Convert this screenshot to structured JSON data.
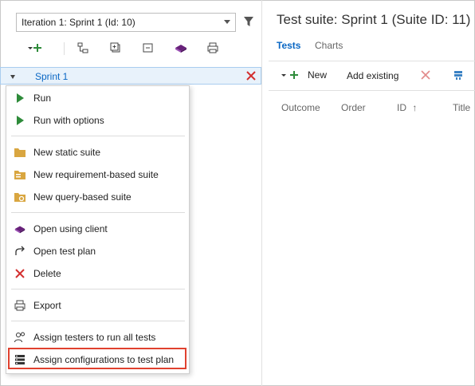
{
  "left_pane": {
    "iteration_selector": {
      "value": "Iteration 1: Sprint 1 (Id: 10)"
    },
    "toolbar": {
      "icons": [
        "new-suite-dropdown-icon",
        "tree-expand-icon",
        "expand-all-icon",
        "collapse-all-icon",
        "open-client-icon",
        "print-icon"
      ]
    },
    "tree": {
      "selected_item": "Sprint 1"
    },
    "context_menu": {
      "items": [
        {
          "label": "Run",
          "icon": "play-icon"
        },
        {
          "label": "Run with options",
          "icon": "play-icon"
        },
        {
          "label": "New static suite",
          "icon": "folder-icon"
        },
        {
          "label": "New requirement-based suite",
          "icon": "requirement-suite-icon"
        },
        {
          "label": "New query-based suite",
          "icon": "query-suite-icon"
        },
        {
          "label": "Open using client",
          "icon": "client-icon"
        },
        {
          "label": "Open test plan",
          "icon": "open-arrow-icon"
        },
        {
          "label": "Delete",
          "icon": "delete-x-icon"
        },
        {
          "label": "Export",
          "icon": "print-icon"
        },
        {
          "label": "Assign testers to run all tests",
          "icon": "testers-icon"
        },
        {
          "label": "Assign configurations to test plan",
          "icon": "configurations-icon"
        }
      ],
      "highlighted_item": "Assign configurations to test plan"
    }
  },
  "right_pane": {
    "title": "Test suite: Sprint 1 (Suite ID: 11)",
    "tabs": [
      {
        "label": "Tests",
        "active": true
      },
      {
        "label": "Charts",
        "active": false
      }
    ],
    "toolbar": {
      "new_label": "New",
      "add_existing_label": "Add existing"
    },
    "columns": [
      "Outcome",
      "Order",
      "ID",
      "Title"
    ]
  },
  "colors": {
    "accent": "#0a67c4",
    "play_green": "#2e8b3a",
    "delete_red": "#d32f2f",
    "highlight_border": "#e0412f",
    "folder": "#d9a640",
    "client_purple": "#68217a"
  }
}
